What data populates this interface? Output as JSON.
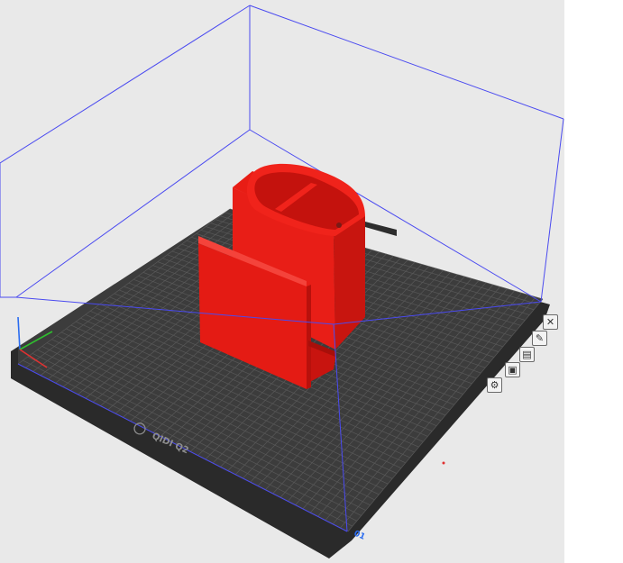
{
  "printer": {
    "brand_label": "QIDI Q2",
    "axis_label": "01"
  },
  "colors": {
    "viewport_bg": "#e9e9e9",
    "bed_top": "#3c3c3c",
    "bed_side": "#2a2a2a",
    "grid_line": "#5a5a5a",
    "model": "#f0201a",
    "build_volume": "#4a4af0",
    "axis_blue": "#2a6cf0",
    "axis_green": "#2fbf2f",
    "axis_red": "#e03030"
  },
  "toolbar": {
    "close_glyph": "✕",
    "buttons": [
      {
        "name": "close-icon",
        "glyph": "✕"
      },
      {
        "name": "edit-file-icon",
        "glyph": "✎"
      },
      {
        "name": "slice-list-icon",
        "glyph": "▤"
      },
      {
        "name": "folder-icon",
        "glyph": "▣"
      },
      {
        "name": "settings-gear-icon",
        "glyph": "⚙"
      }
    ]
  }
}
